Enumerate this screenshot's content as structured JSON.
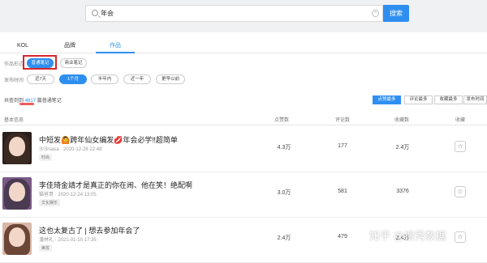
{
  "search": {
    "query": "年会",
    "button": "搜索",
    "clear": "×"
  },
  "tabs": [
    "KOL",
    "品牌",
    "作品"
  ],
  "filters": {
    "type_label": "作品形式",
    "type_options": [
      "普通笔记",
      "商业笔记"
    ],
    "time_label": "发布时间",
    "time_options": [
      "近7天",
      "1个月",
      "半年内",
      "近一年",
      "更早以前"
    ]
  },
  "total": {
    "prefix": "共查到到",
    "count": "4817",
    "suffix": "篇普通笔记"
  },
  "sort": [
    "点赞最多",
    "评论最多",
    "收藏最多",
    "发布时间"
  ],
  "table": {
    "headers": [
      "基本信息",
      "点赞数",
      "评论数",
      "收藏数",
      "收藏"
    ],
    "rows": [
      {
        "title": "中短发🙆跨年仙女编发💋年会必学‼超简单",
        "author": "沙沙sasa",
        "date": "2020-12-28 22:48",
        "tag": "时尚",
        "likes": "4.3万",
        "comments": "177",
        "collects": "2.4万"
      },
      {
        "title": "李佳琦金靖才是真正的你在闹、他在笑！绝配啊",
        "author": "猫爸哥",
        "date": "2020-12-24 13:05",
        "tag": "文化娱乐",
        "likes": "3.0万",
        "comments": "581",
        "collects": "3376"
      },
      {
        "title": "这也太复古了 | 想去参加年会了",
        "author": "潘林礼",
        "date": "2021-01-10 17:35",
        "tag": "美妆",
        "likes": "2.4万",
        "comments": "479",
        "collects": "2.4万"
      }
    ]
  },
  "watermark": "知乎 @搜秀数据",
  "star_glyph": "☆",
  "colors": {
    "accent": "#2f8ff0",
    "highlight": "#d9252b"
  }
}
